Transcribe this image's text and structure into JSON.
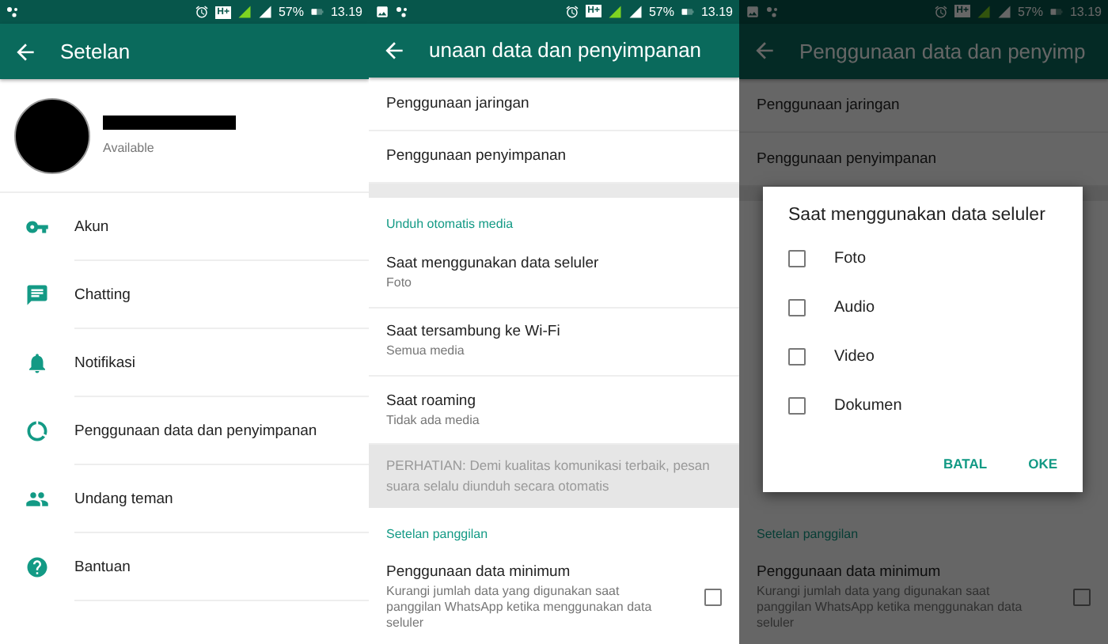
{
  "screens": [
    {
      "kind": "settings",
      "status_bar": {
        "network_type": "H+",
        "battery": "57%",
        "time": "13.19"
      },
      "toolbar": {
        "title": "Setelan"
      },
      "profile": {
        "status": "Available"
      },
      "items": [
        {
          "label": "Akun"
        },
        {
          "label": "Chatting"
        },
        {
          "label": "Notifikasi"
        },
        {
          "label": "Penggunaan data dan penyimpanan"
        },
        {
          "label": "Undang teman"
        },
        {
          "label": "Bantuan"
        }
      ]
    },
    {
      "kind": "list",
      "status_bar": {
        "image_notice": true,
        "network_type": "H+",
        "battery": "57%",
        "time": "13.19"
      },
      "toolbar": {
        "title": "unaan data dan penyimpanan"
      },
      "rows": [
        {
          "kind": "link",
          "title": "Penggunaan jaringan"
        },
        {
          "kind": "link",
          "title": "Penggunaan penyimpanan"
        },
        {
          "kind": "gap"
        },
        {
          "kind": "section",
          "title": "Unduh otomatis media"
        },
        {
          "kind": "option",
          "title": "Saat menggunakan data seluler",
          "subtitle": "Foto"
        },
        {
          "kind": "option",
          "title": "Saat tersambung ke Wi-Fi",
          "subtitle": "Semua media"
        },
        {
          "kind": "option",
          "title": "Saat roaming",
          "subtitle": "Tidak ada media"
        },
        {
          "kind": "notice",
          "text": "PERHATIAN: Demi kualitas komunikasi terbaik, pesan suara selalu diunduh secara otomatis"
        },
        {
          "kind": "section",
          "title": "Setelan panggilan"
        },
        {
          "kind": "checkbox",
          "title": "Penggunaan data minimum",
          "subtitle": "Kurangi jumlah data yang digunakan saat panggilan WhatsApp ketika menggunakan data seluler",
          "checked": false
        }
      ]
    },
    {
      "kind": "list",
      "status_bar": {
        "image_notice": true,
        "network_type": "H+",
        "battery": "57%",
        "time": "13.19"
      },
      "toolbar": {
        "title": "Penggunaan data dan penyimp"
      },
      "rows": [
        {
          "kind": "link",
          "title": "Penggunaan jaringan"
        },
        {
          "kind": "link",
          "title": "Penggunaan penyimpanan"
        },
        {
          "kind": "gap"
        },
        {
          "kind": "covered"
        },
        {
          "kind": "section",
          "title": "Setelan panggilan"
        },
        {
          "kind": "checkbox",
          "title": "Penggunaan data minimum",
          "subtitle": "Kurangi jumlah data yang digunakan saat panggilan WhatsApp ketika menggunakan data seluler",
          "checked": false
        }
      ],
      "dialog": {
        "title": "Saat menggunakan data seluler",
        "options": [
          {
            "label": "Foto",
            "checked": false
          },
          {
            "label": "Audio",
            "checked": false
          },
          {
            "label": "Video",
            "checked": false
          },
          {
            "label": "Dokumen",
            "checked": false
          }
        ],
        "buttons": [
          "BATAL",
          "OKE"
        ]
      }
    }
  ]
}
